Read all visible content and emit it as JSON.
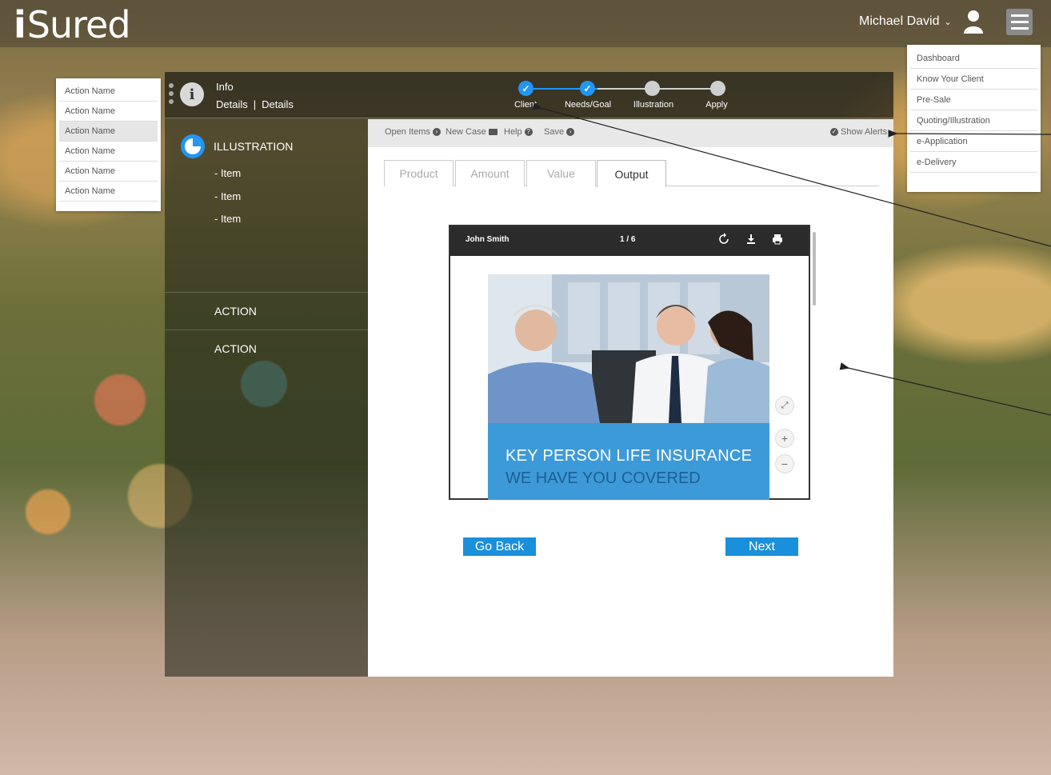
{
  "brand": {
    "logo_text": "Sured",
    "logo_mark": "i"
  },
  "header": {
    "user_name": "Michael David",
    "user_icon": "user-icon",
    "menu_icon": "hamburger-icon"
  },
  "main_menu": {
    "items": [
      "Dashboard",
      "Know Your Client",
      "Pre-Sale",
      "Quoting/Illustration",
      "e-Application",
      "e-Delivery"
    ]
  },
  "action_menu": {
    "items": [
      "Action Name",
      "Action Name",
      "Action Name",
      "Action Name",
      "Action Name",
      "Action Name"
    ],
    "active_index": 2
  },
  "info": {
    "title": "Info",
    "details_1": "Details",
    "separator": "|",
    "details_2": "Details"
  },
  "stepper": {
    "steps": [
      {
        "label": "Client",
        "state": "done"
      },
      {
        "label": "Needs/Goal",
        "state": "done"
      },
      {
        "label": "Illustration",
        "state": "todo"
      },
      {
        "label": "Apply",
        "state": "todo"
      }
    ]
  },
  "sidebar": {
    "title": "ILLUSTRATION",
    "items": [
      "- Item",
      "- Item",
      "- Item"
    ],
    "actions": [
      "ACTION",
      "ACTION"
    ]
  },
  "toolbar": {
    "open_items": "Open Items",
    "new_case": "New Case",
    "help": "Help",
    "save": "Save",
    "show_alerts": "Show Alerts"
  },
  "tabs": [
    {
      "label": "Product",
      "active": false
    },
    {
      "label": "Amount",
      "active": false
    },
    {
      "label": "Value",
      "active": false
    },
    {
      "label": "Output",
      "active": true
    }
  ],
  "viewer": {
    "doc_name": "John Smith",
    "page_indicator": "1 / 6",
    "banner_title": "KEY PERSON LIFE INSURANCE",
    "banner_subtitle": "WE HAVE YOU COVERED",
    "zoom_in": "+",
    "zoom_out": "−"
  },
  "buttons": {
    "go_back": "Go Back",
    "next": "Next"
  },
  "colors": {
    "accent": "#1a8fdc",
    "step_done": "#2196f3",
    "banner": "#3d9ad9"
  }
}
